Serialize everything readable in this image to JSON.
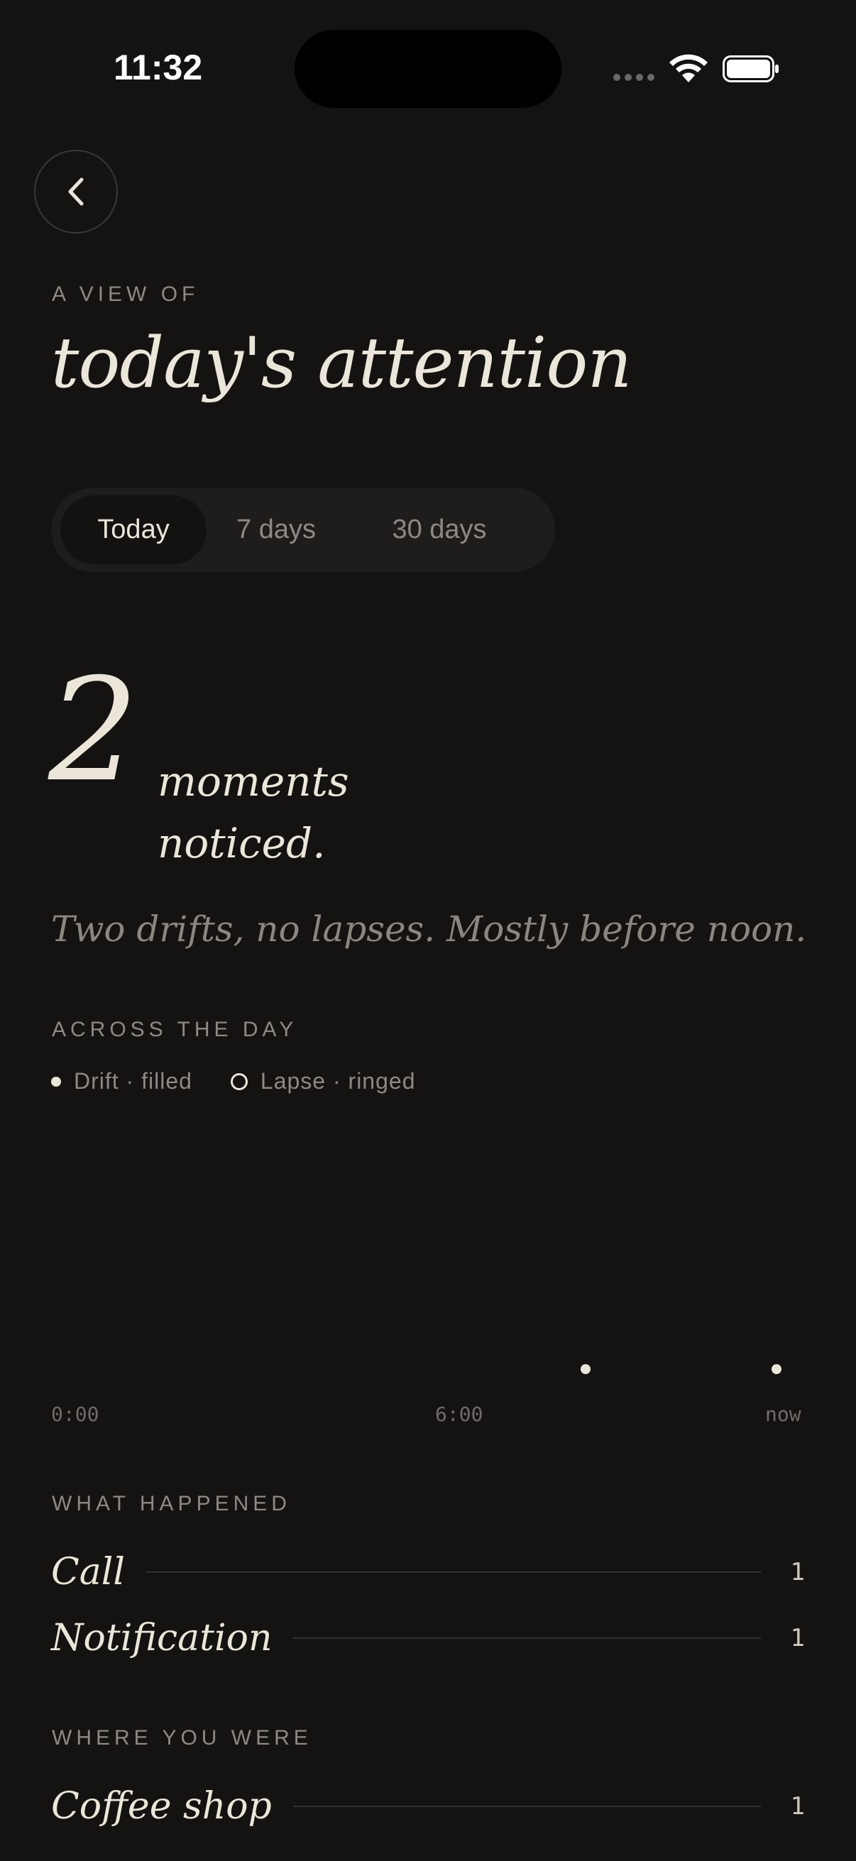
{
  "status_bar": {
    "time": "11:32",
    "icons": [
      "signal-icon",
      "wifi-icon",
      "battery-icon"
    ]
  },
  "header": {
    "back_icon": "chevron-left-icon",
    "eyebrow": "A VIEW OF",
    "title": "today's attention"
  },
  "range_tabs": {
    "items": [
      {
        "label": "Today",
        "active": true
      },
      {
        "label": "7 days",
        "active": false
      },
      {
        "label": "30 days",
        "active": false
      }
    ]
  },
  "summary": {
    "count": "2",
    "unit_line1": "moments",
    "unit_line2": "noticed.",
    "description": "Two drifts, no lapses. Mostly before noon."
  },
  "timeline": {
    "eyebrow": "ACROSS THE DAY",
    "legend": {
      "drift": "Drift · filled",
      "lapse": "Lapse · ringed"
    },
    "axis_labels": [
      "0:00",
      "6:00",
      "now"
    ],
    "events": [
      {
        "kind": "drift",
        "time": "9:04"
      },
      {
        "kind": "drift",
        "time": "11:32"
      }
    ]
  },
  "what_happened": {
    "eyebrow": "WHAT HAPPENED",
    "items": [
      {
        "label": "Call",
        "count": "1"
      },
      {
        "label": "Notification",
        "count": "1"
      }
    ]
  },
  "where_you_were": {
    "eyebrow": "WHERE YOU WERE",
    "items": [
      {
        "label": "Coffee shop",
        "count": "1"
      }
    ]
  },
  "colors": {
    "background": "#141312",
    "text": "#ece6da",
    "muted": "#8d8a84"
  }
}
